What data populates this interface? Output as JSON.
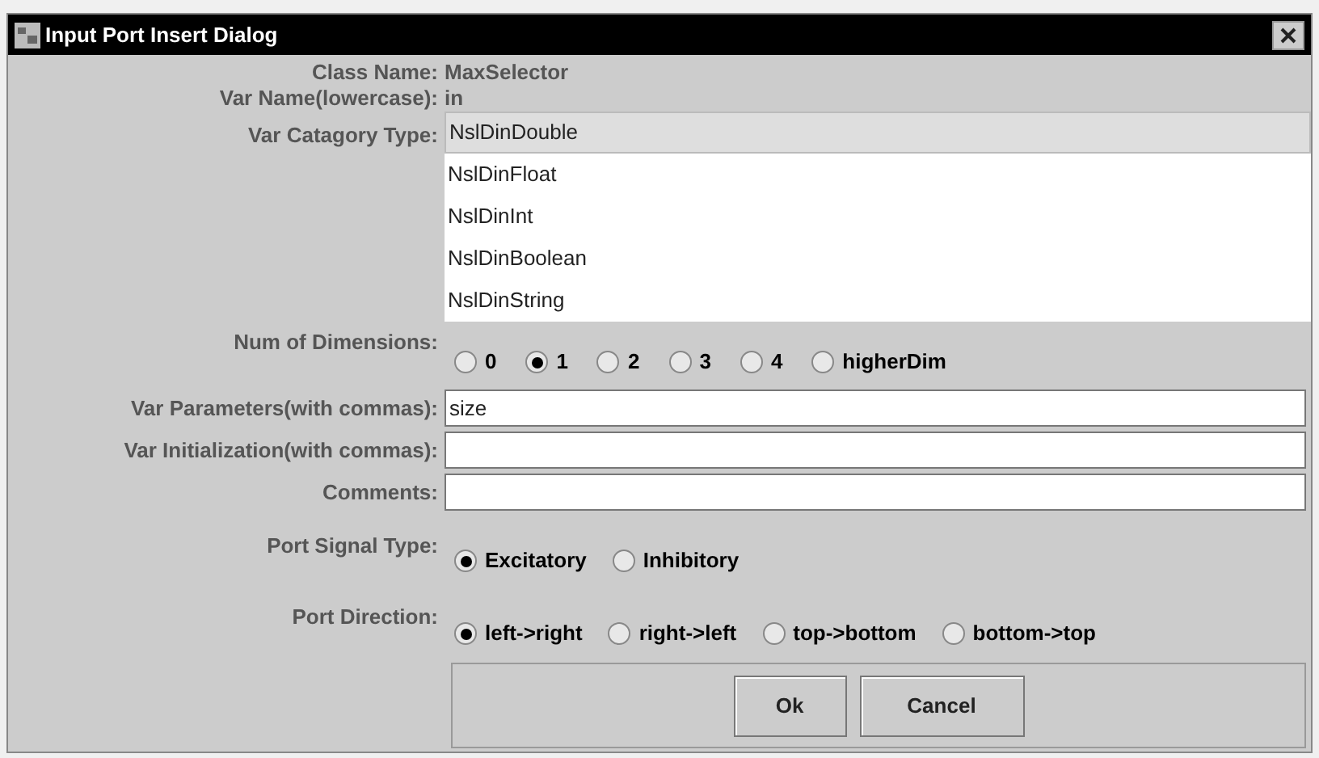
{
  "window": {
    "title": "Input Port Insert Dialog"
  },
  "class_name": {
    "label": "Class Name:",
    "value": "MaxSelector"
  },
  "var_name": {
    "label": "Var Name(lowercase):",
    "value": "in"
  },
  "var_category_type": {
    "label": "Var Catagory Type:",
    "items": [
      {
        "label": "NslDinDouble",
        "selected": true
      },
      {
        "label": "NslDinFloat",
        "selected": false
      },
      {
        "label": "NslDinInt",
        "selected": false
      },
      {
        "label": "NslDinBoolean",
        "selected": false
      },
      {
        "label": "NslDinString",
        "selected": false
      }
    ]
  },
  "num_of_dimensions": {
    "label": "Num of Dimensions:",
    "options": [
      {
        "label": "0",
        "selected": false
      },
      {
        "label": "1",
        "selected": true
      },
      {
        "label": "2",
        "selected": false
      },
      {
        "label": "3",
        "selected": false
      },
      {
        "label": "4",
        "selected": false
      },
      {
        "label": "higherDim",
        "selected": false
      }
    ]
  },
  "fields": [
    {
      "label": "Var Parameters(with commas):",
      "value": "size"
    },
    {
      "label": "Var Initialization(with commas):"
    },
    {
      "label": "Comments:"
    }
  ],
  "port_signal_type": {
    "label": "Port Signal Type:",
    "options": [
      {
        "label": "Excitatory",
        "selected": true
      },
      {
        "label": "Inhibitory",
        "selected": false
      }
    ]
  },
  "port_direction": {
    "label": "Port Direction:",
    "options": [
      {
        "label": "left->right",
        "selected": true
      },
      {
        "label": "right->left",
        "selected": false
      },
      {
        "label": "top->bottom",
        "selected": false
      },
      {
        "label": "bottom->top",
        "selected": false
      }
    ]
  },
  "buttons": [
    "Ok",
    "Cancel"
  ]
}
